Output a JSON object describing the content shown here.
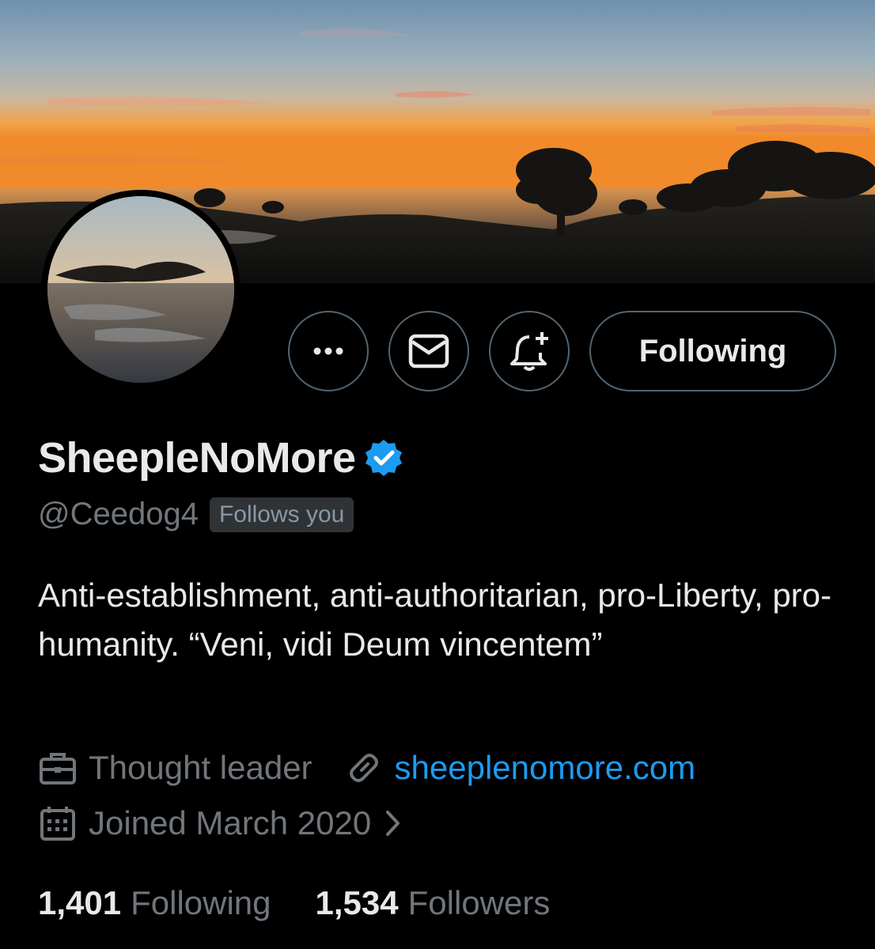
{
  "profile": {
    "display_name": "SheepleNoMore",
    "handle": "@Ceedog4",
    "follows_you_badge": "Follows you",
    "bio": "Anti-establishment, anti-authoritarian, pro-Liberty, pro-humanity. “Veni, vidi Deum vincentem”",
    "occupation": "Thought leader",
    "website": "sheeplenomore.com",
    "joined": "Joined March 2020"
  },
  "actions": {
    "following_label": "Following"
  },
  "stats": {
    "following_count": "1,401",
    "following_label": "Following",
    "followers_count": "1,534",
    "followers_label": "Followers"
  },
  "icons": {
    "more": "more-dots-icon",
    "message": "envelope-icon",
    "notify": "bell-plus-icon",
    "verified": "verified-badge-icon",
    "occupation": "briefcase-icon",
    "website": "link-icon",
    "joined": "calendar-icon",
    "joined_more": "chevron-right-icon"
  },
  "colors": {
    "background": "#000000",
    "text_primary": "#e7e9ea",
    "text_secondary": "#71767b",
    "accent": "#1d9bf0",
    "border": "#536471",
    "badge_bg": "#2f3336"
  }
}
